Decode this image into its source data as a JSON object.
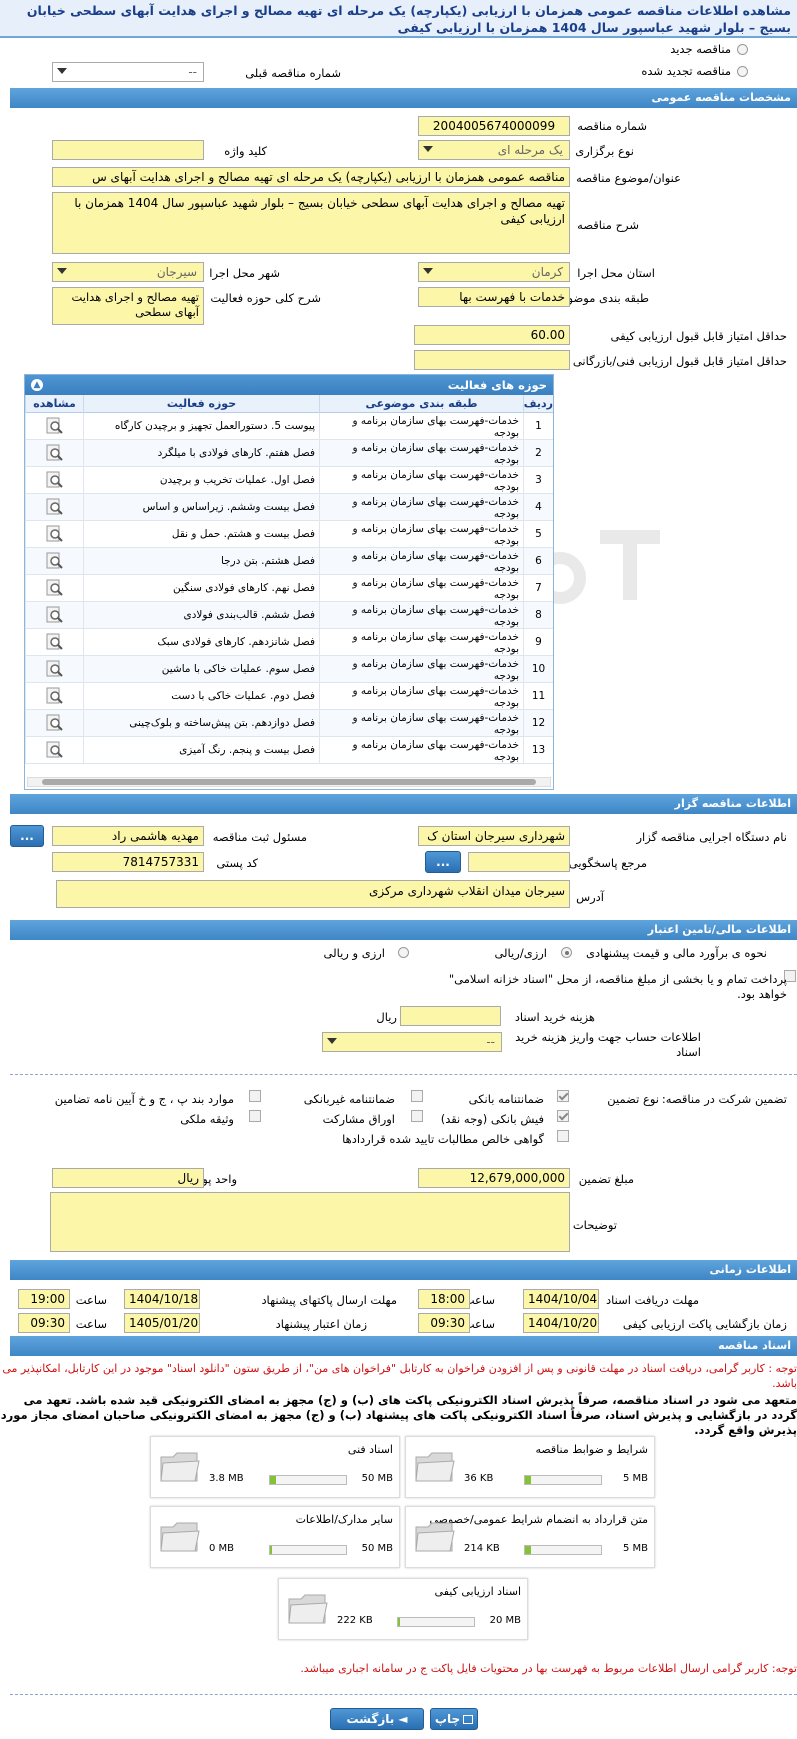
{
  "title": "مشاهده اطلاعات مناقصه عمومی همزمان با ارزیابی (یکپارچه) یک مرحله ای تهیه مصالح و اجرای هدایت آبهای سطحی خیابان بسیج – بلوار شهید عباسپور سال 1404 همزمان با ارزیابی کیفی",
  "top": {
    "new_label": "مناقصه جدید",
    "renewed_label": "مناقصه تجدید شده",
    "prev_no_label": "شماره مناقصه قبلی",
    "prev_no_value": "--"
  },
  "sections": {
    "general": "مشخصات مناقصه عمومی",
    "organizer": "اطلاعات مناقصه گزار",
    "finance": "اطلاعات مالی/تامین اعتبار",
    "time": "اطلاعات زمانی",
    "docs": "اسناد مناقصه"
  },
  "general": {
    "no_label": "شماره مناقصه",
    "no_value": "2004005674000099",
    "type_label": "نوع برگزاری",
    "type_value": "یک مرحله ای",
    "keyword_label": "کلید واژه",
    "keyword_value": "",
    "subject_label": "عنوان/موضوع مناقصه",
    "subject_value": "مناقصه عمومی همزمان با ارزیابی (یکپارچه) یک مرحله ای تهیه مصالح و اجرای  هدایت آبهای س",
    "desc_label": "شرح مناقصه",
    "desc_value": "تهیه مصالح و اجرای  هدایت آبهای سطحی خیابان بسیج – بلوار شهید عباسپور سال 1404 همزمان با ارزیابی کیفی",
    "province_label": "استان محل اجرا",
    "province_value": "کرمان",
    "city_label": "شهر محل اجرا",
    "city_value": "سیرجان",
    "category_label": "طبقه بندی موضوعی",
    "category_value": "خدمات با فهرست بها",
    "scope_label": "شرح کلی حوزه فعالیت",
    "scope_value": "تهیه مصالح و اجرای  هدایت آبهای سطحی",
    "minq_label": "حداقل امتیاز قابل قبول ارزیابی کیفی",
    "minq_value": "60.00",
    "mint_label": "حداقل امتیاز قابل قبول ارزیابی فنی/بازرگانی",
    "mint_value": ""
  },
  "grid": {
    "title": "حوزه های فعالیت",
    "col_no": "ردیف",
    "col_cat": "طبقه بندی موضوعی",
    "col_act": "حوزه فعالیت",
    "col_view": "مشاهده",
    "rows": [
      {
        "no": "1",
        "cat": "خدمات-فهرست بهای سازمان برنامه و بودجه",
        "act": "پیوست 5. دستورالعمل تجهیز و برچیدن کارگاه"
      },
      {
        "no": "2",
        "cat": "خدمات-فهرست بهای سازمان برنامه و بودجه",
        "act": "فصل هفتم. کارهای فولادی با میلگرد"
      },
      {
        "no": "3",
        "cat": "خدمات-فهرست بهای سازمان برنامه و بودجه",
        "act": "فصل اول. عملیات تخریب و برچیدن"
      },
      {
        "no": "4",
        "cat": "خدمات-فهرست بهای سازمان برنامه و بودجه",
        "act": "فصل بیست وششم. زیراساس و اساس"
      },
      {
        "no": "5",
        "cat": "خدمات-فهرست بهای سازمان برنامه و بودجه",
        "act": "فصل بیست و هشتم. حمل و نقل"
      },
      {
        "no": "6",
        "cat": "خدمات-فهرست بهای سازمان برنامه و بودجه",
        "act": "فصل هشتم. بتن درجا"
      },
      {
        "no": "7",
        "cat": "خدمات-فهرست بهای سازمان برنامه و بودجه",
        "act": "فصل نهم. کارهای فولادی سنگین"
      },
      {
        "no": "8",
        "cat": "خدمات-فهرست بهای سازمان برنامه و بودجه",
        "act": "فصل ششم. قالب‌بندی فولادی"
      },
      {
        "no": "9",
        "cat": "خدمات-فهرست بهای سازمان برنامه و بودجه",
        "act": "فصل شانزدهم. کارهای فولادی سبک"
      },
      {
        "no": "10",
        "cat": "خدمات-فهرست بهای سازمان برنامه و بودجه",
        "act": "فصل سوم. عملیات خاکی با ماشین"
      },
      {
        "no": "11",
        "cat": "خدمات-فهرست بهای سازمان برنامه و بودجه",
        "act": "فصل دوم. عملیات خاکی با دست"
      },
      {
        "no": "12",
        "cat": "خدمات-فهرست بهای سازمان برنامه و بودجه",
        "act": "فصل دوازدهم. بتن پیش‌ساخته و بلوک‌چینی"
      },
      {
        "no": "13",
        "cat": "خدمات-فهرست بهای سازمان برنامه و بودجه",
        "act": "فصل بیست و پنجم. رنگ آمیزی"
      }
    ]
  },
  "organizer": {
    "org_label": "نام دستگاه اجرایی مناقصه گزار",
    "org_value": "شهرداری سیرجان استان ک",
    "resp_label": "مسئول ثبت مناقصه",
    "resp_value": "مهدیه هاشمی راد",
    "ref_label": "مرجع پاسخگویی",
    "ref_value": "",
    "postal_label": "کد پستی",
    "postal_value": "7814757331",
    "address_label": "آدرس",
    "address_value": "سیرجان میدان انقلاب شهرداری مرکزی",
    "dots": "..."
  },
  "finance": {
    "estimate_label": "نحوه ی برآورد مالی و قیمت پیشنهادی",
    "opt1": "ارزی/ریالی",
    "opt2": "ارزی و ریالی",
    "islamic_text": "پرداخت تمام و یا بخشی از مبلغ مناقصه، از محل \"اسناد خزانه اسلامی\" خواهد بود.",
    "docfee_label": "هزینه خرید اسناد",
    "docfee_unit": "ریال",
    "account_label": "اطلاعات حساب جهت واریز هزینه خرید اسناد",
    "account_value": "--",
    "guarantee_label": "تضمین شرکت در مناقصه:",
    "gtype_label": "نوع تضمین",
    "g_bank": "ضمانتنامه بانکی",
    "g_nonbank": "ضمانتنامه غیربانکی",
    "g_items": "موارد بند پ ، ج و خ آیین نامه تضامین",
    "g_cash": "فیش بانکی (وجه نقد)",
    "g_bonds": "اوراق مشارکت",
    "g_property": "وثیقه ملکی",
    "g_claims": "گواهی خالص مطالبات تایید شده قراردادها",
    "amount_label": "مبلغ تضمین",
    "amount_value": "12,679,000,000",
    "currency_label": "واحد پول",
    "currency_value": "ریال",
    "notes_label": "توضیحات",
    "notes_value": ""
  },
  "time": {
    "recv_label": "مهلت دریافت اسناد",
    "recv_date": "1404/10/04",
    "recv_time": "18:00",
    "send_label": "مهلت ارسال پاکتهای پیشنهاد",
    "send_date": "1404/10/18",
    "send_time": "19:00",
    "open_label": "زمان بازگشایی پاکت ارزیابی کیفی",
    "open_date": "1404/10/20",
    "open_time": "09:30",
    "valid_label": "زمان اعتبار پیشنهاد",
    "valid_date": "1405/01/20",
    "valid_time": "09:30",
    "time_word": "ساعت"
  },
  "docs": {
    "note1": "توجه : کاربر گرامی، دریافت اسناد در مهلت قانونی و پس از افزودن فراخوان به کارتابل \"فراخوان های من\"، از طریق ستون \"دانلود اسناد\" موجود در این کارتابل، امکانپذیر می باشد.",
    "note2": "متعهد می شود در اسناد مناقصه، صرفاً پذیرش اسناد الکترونیکی پاکت های (ب) و (ج) مجهز به امضای الکترونیکی قید شده باشد. تعهد می گردد در بازگشایی و پذیرش اسناد، صرفاً اسناد الکترونیکی پاکت های پیشنهاد (ب) و (ج) مجهز به امضای الکترونیکی صاحبان امضای مجاز مورد پذیرش واقع گردد.",
    "files": [
      {
        "name": "شرایط و ضوابط مناقصه",
        "size": "36 KB",
        "max": "5 MB",
        "fill": 0.08
      },
      {
        "name": "اسناد فنی",
        "size": "3.8 MB",
        "max": "50 MB",
        "fill": 0.08
      },
      {
        "name": "متن قرارداد به انضمام شرایط عمومی/خصوصی",
        "size": "214 KB",
        "max": "5 MB",
        "fill": 0.08
      },
      {
        "name": "سایر مدارک/اطلاعات",
        "size": "0 MB",
        "max": "50 MB",
        "fill": 0
      },
      {
        "name": "اسناد ارزیابی کیفی",
        "size": "222 KB",
        "max": "20 MB",
        "fill": 0.02
      }
    ],
    "note3": "توجه: کاربر گرامی ارسال اطلاعات مربوط به فهرست بها در محتویات فایل پاکت ج در سامانه اجباری میباشد."
  },
  "buttons": {
    "back": "بازگشت",
    "print": "چاپ"
  },
  "colors": {
    "field": "#fbf6a8",
    "header": "#3f86c6",
    "red_note": "#d01010"
  }
}
